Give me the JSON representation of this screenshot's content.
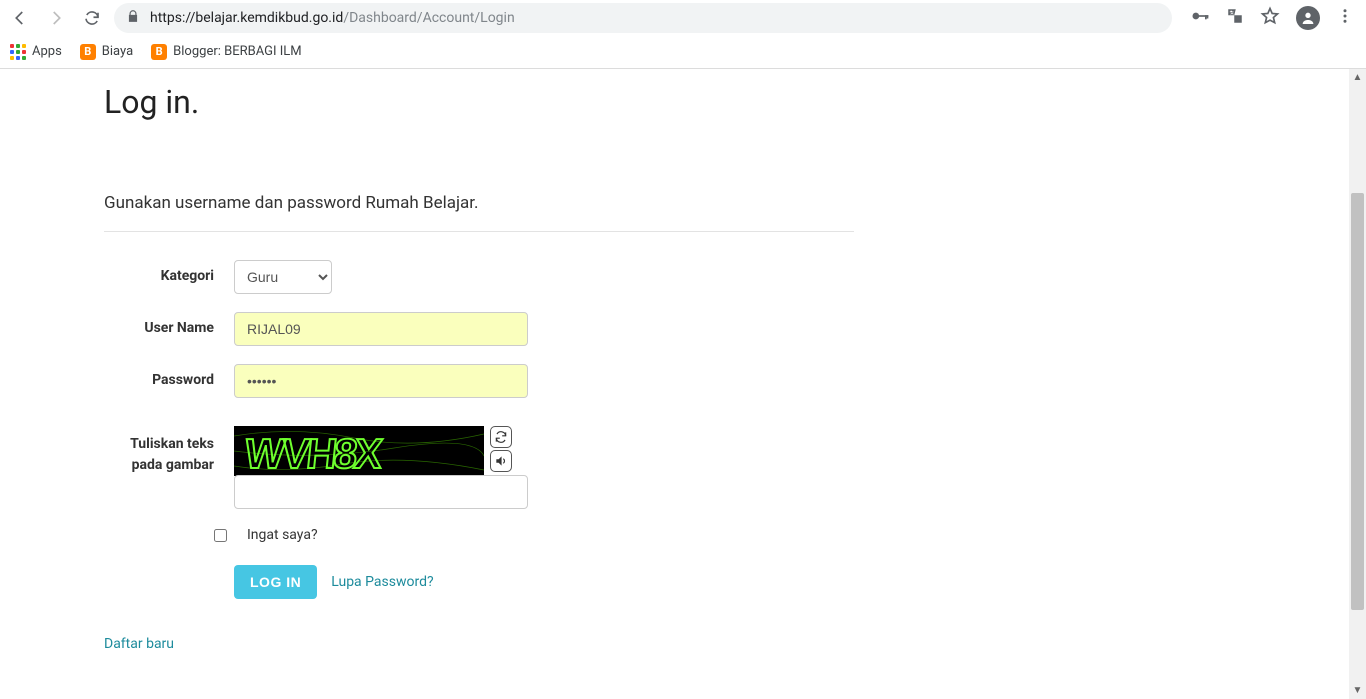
{
  "browser": {
    "url_host": "belajar.kemdikbud.go.id",
    "url_path": "/Dashboard/Account/Login",
    "bookmarks": {
      "apps": "Apps",
      "biaya": "Biaya",
      "blogger": "Blogger: BERBAGI ILM"
    }
  },
  "page": {
    "title": "Log in.",
    "subtitle": "Gunakan username dan password Rumah Belajar.",
    "labels": {
      "kategori": "Kategori",
      "username": "User Name",
      "password": "Password",
      "captcha": "Tuliskan teks pada gambar",
      "remember": "Ingat saya?"
    },
    "fields": {
      "kategori_value": "Guru",
      "username_value": "RIJAL09",
      "password_value": "••••••",
      "captcha_value": ""
    },
    "captcha_text": "WVH8X",
    "actions": {
      "login": "LOG IN",
      "forgot": "Lupa Password?",
      "register": "Daftar baru"
    }
  },
  "scrollbar": {
    "thumb_top_pct": 18,
    "thumb_height_pct": 70
  }
}
